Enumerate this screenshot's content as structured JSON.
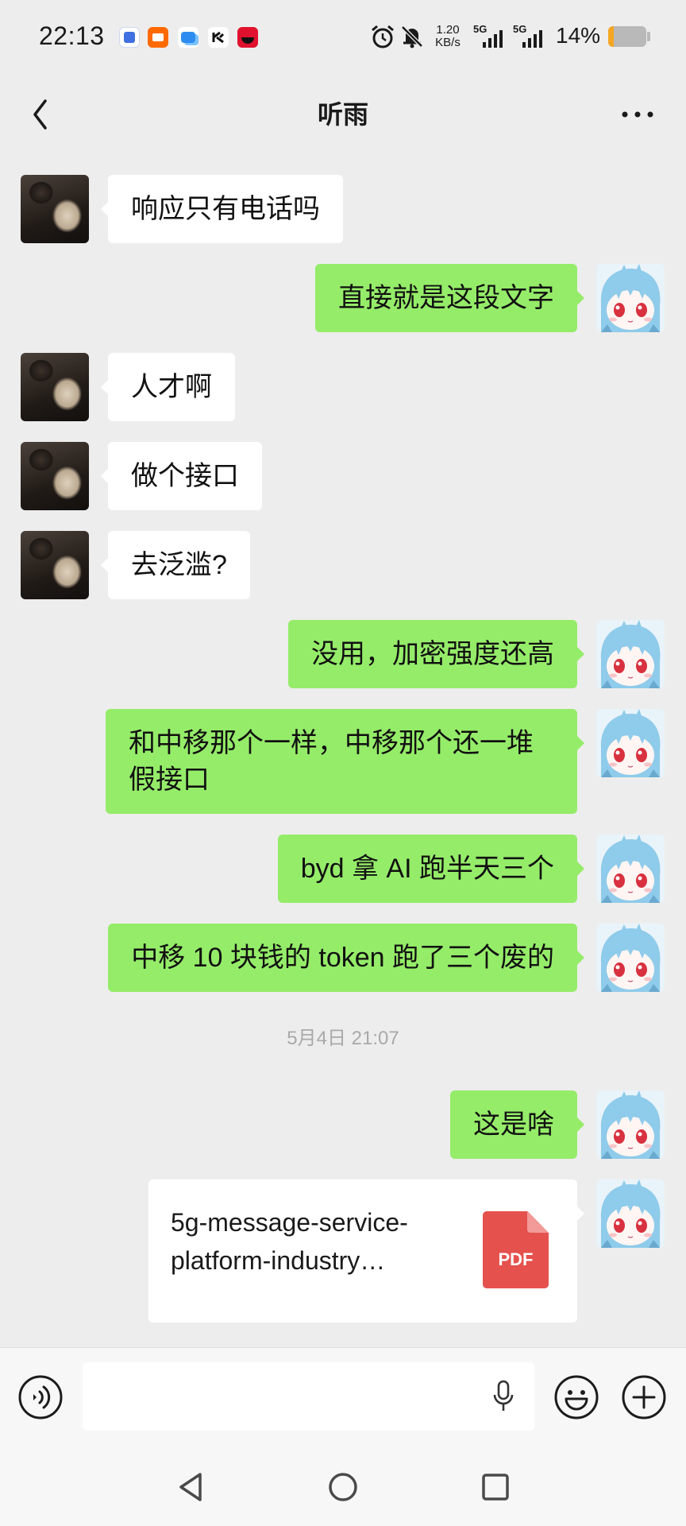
{
  "colors": {
    "background": "#ededed",
    "sent_bubble": "#95ec69",
    "received_bubble": "#ffffff",
    "pdf_icon": "#e5514d"
  },
  "status_bar": {
    "time": "22:13",
    "app_icons": [
      "tieba-icon",
      "taobao-icon",
      "message-app-icon",
      "app-icon",
      "tmall-icon"
    ],
    "alarm_icon": "alarm-clock-icon",
    "mute_icon": "bell-off-icon",
    "net_speed_value": "1.20",
    "net_speed_unit": "KB/s",
    "signal_1_label": "5G",
    "signal_2_label": "5G",
    "battery_text": "14%",
    "battery_level": 0.14
  },
  "header": {
    "back_icon": "chevron-left-icon",
    "title": "听雨",
    "more_icon": "more-dots-icon"
  },
  "messages": [
    {
      "type": "text",
      "side": "left",
      "text": "响应只有电话吗"
    },
    {
      "type": "text",
      "side": "right",
      "text": "直接就是这段文字"
    },
    {
      "type": "text",
      "side": "left",
      "text": "人才啊"
    },
    {
      "type": "text",
      "side": "left",
      "text": "做个接口"
    },
    {
      "type": "text",
      "side": "left",
      "text": "去泛滥?"
    },
    {
      "type": "text",
      "side": "right",
      "text": "没用，加密强度还高"
    },
    {
      "type": "text",
      "side": "right",
      "text": "和中移那个一样，中移那个还一堆假接口"
    },
    {
      "type": "text",
      "side": "right",
      "text": "byd 拿 AI 跑半天三个"
    },
    {
      "type": "text",
      "side": "right",
      "text": "中移 10 块钱的 token 跑了三个废的"
    },
    {
      "type": "time",
      "text": "5月4日 21:07"
    },
    {
      "type": "text",
      "side": "right",
      "text": "这是啥"
    },
    {
      "type": "file",
      "side": "right",
      "filename_lines": [
        "5g-message-service-",
        "platform-industry…"
      ],
      "file_type": "PDF"
    }
  ],
  "input_bar": {
    "voice_icon": "voice-input-icon",
    "mic_icon": "microphone-icon",
    "emoji_icon": "emoji-icon",
    "plus_icon": "plus-icon",
    "value": ""
  },
  "nav_bar": {
    "back_icon": "nav-back-icon",
    "home_icon": "nav-home-icon",
    "recent_icon": "nav-recent-apps-icon"
  }
}
